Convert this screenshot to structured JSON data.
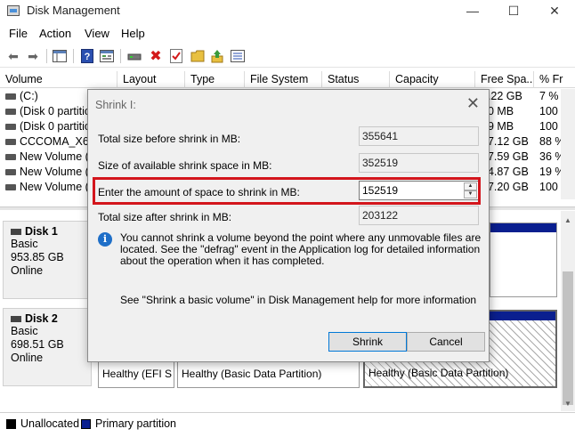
{
  "window": {
    "title": "Disk Management",
    "min": "—",
    "max": "☐",
    "close": "✕"
  },
  "menu": [
    "File",
    "Action",
    "View",
    "Help"
  ],
  "columns": [
    "Volume",
    "Layout",
    "Type",
    "File System",
    "Status",
    "Capacity",
    "Free Spa...",
    "% Fr"
  ],
  "volumes": [
    {
      "name": "(C:)",
      "free": "0.22 GB",
      "pct": "7 %"
    },
    {
      "name": "(Disk 0 partitio",
      "free": "00 MB",
      "pct": "100 '"
    },
    {
      "name": "(Disk 0 partitio",
      "free": "99 MB",
      "pct": "100 '"
    },
    {
      "name": "CCCOMA_X64",
      "free": "97.12 GB",
      "pct": "88 %"
    },
    {
      "name": "New Volume (",
      "free": "17.59 GB",
      "pct": "36 %"
    },
    {
      "name": "New Volume (",
      "free": "34.87 GB",
      "pct": "19 %"
    },
    {
      "name": "New Volume (",
      "free": "47.20 GB",
      "pct": "100 '"
    }
  ],
  "disks": [
    {
      "name": "Disk 1",
      "type": "Basic",
      "size": "953.85 GB",
      "status": "Online"
    },
    {
      "name": "Disk 2",
      "type": "Basic",
      "size": "698.51 GB",
      "status": "Online"
    }
  ],
  "partitions_disk2": [
    "Healthy (EFI S",
    "Healthy (Basic Data Partition)",
    "Healthy (Basic Data Partition)"
  ],
  "legend": {
    "unallocated": "Unallocated",
    "primary": "Primary partition"
  },
  "dialog": {
    "title": "Shrink I:",
    "close": "✕",
    "total_before_label": "Total size before shrink in MB:",
    "total_before_value": "355641",
    "available_label": "Size of available shrink space in MB:",
    "available_value": "352519",
    "amount_label": "Enter the amount of space to shrink in MB:",
    "amount_value": "152519",
    "total_after_label": "Total size after shrink in MB:",
    "total_after_value": "203122",
    "info_text": "You cannot shrink a volume beyond the point where any unmovable files are located. See the \"defrag\" event in the Application log for detailed information about the operation when it has completed.",
    "help_text": "See \"Shrink a basic volume\" in Disk Management help for more information",
    "shrink_button": "Shrink",
    "cancel_button": "Cancel"
  },
  "colors": {
    "primary_partition": "#0a1f8f",
    "highlight": "#d3151c",
    "info": "#1f6fc8"
  }
}
